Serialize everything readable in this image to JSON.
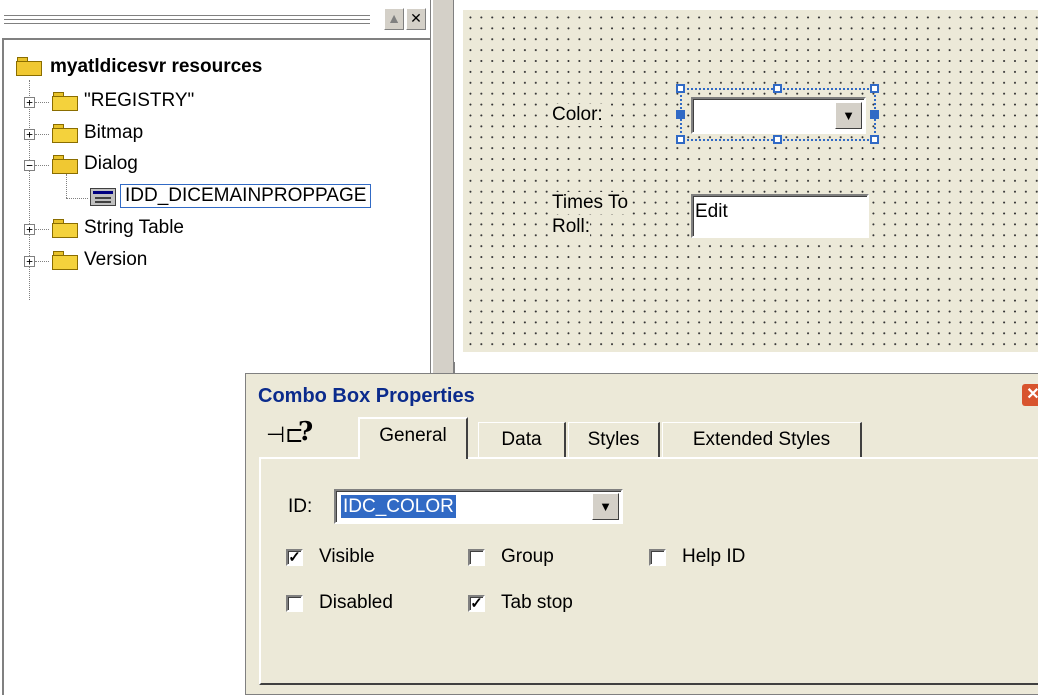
{
  "tree": {
    "root": {
      "label": "myatldicesvr resources"
    },
    "items": [
      {
        "label": "\"REGISTRY\"",
        "expander": "+"
      },
      {
        "label": "Bitmap",
        "expander": "+"
      },
      {
        "label": "Dialog",
        "expander": "−"
      },
      {
        "label": "IDD_DICEMAINPROPPAGE",
        "selected": true
      },
      {
        "label": "String Table",
        "expander": "+"
      },
      {
        "label": "Version",
        "expander": "+"
      }
    ]
  },
  "editor": {
    "color_label": "Color:",
    "times_label_line1": "Times To",
    "times_label_line2": "Roll:",
    "times_edit_value": "Edit",
    "combo_drop_glyph": "▼"
  },
  "properties": {
    "title": "Combo Box Properties",
    "close_glyph": "✕",
    "pin_glyph": "⊣⊏",
    "help_glyph": "?",
    "tabs": [
      "General",
      "Data",
      "Styles",
      "Extended Styles"
    ],
    "active_tab": "General",
    "id_label": "ID:",
    "id_value": "IDC_COLOR",
    "checkboxes": {
      "visible": {
        "label": "Visible",
        "checked": true
      },
      "group": {
        "label": "Group",
        "checked": false
      },
      "help_id": {
        "label": "Help ID",
        "checked": false
      },
      "disabled": {
        "label": "Disabled",
        "checked": false
      },
      "tab_stop": {
        "label": "Tab stop",
        "checked": true
      }
    },
    "check_glyph": "✓"
  },
  "colors": {
    "accent": "#316ac5",
    "dialog_bg": "#ece9d8",
    "title_text": "#0b2b8c",
    "close_button": "#d8542e"
  },
  "icons": [
    "folder-open-icon",
    "folder-icon",
    "dialog-resource-icon",
    "pin-icon",
    "help-icon",
    "close-icon",
    "dropdown-arrow-icon"
  ]
}
